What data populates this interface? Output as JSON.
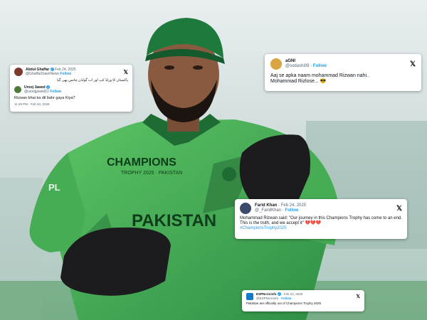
{
  "tweets": [
    {
      "name": "Abdul Ghaffar",
      "handle": "@GhaffarDawnNews",
      "date": "Feb 24, 2025",
      "follow": "Follow",
      "text": "پاکستان کا ورلڈ کپ اور اب گولڈن چانس بھی گیا",
      "reply_name": "Urooj Jawed",
      "reply_handle": "@uroojjawed12",
      "reply_follow": "Follow",
      "reply_text": "Rizwan bhai ka dil bahr gaya Kiya?",
      "time": "11:29 PM · Feb 24, 2025",
      "x_logo": "𝕏"
    },
    {
      "name": "aGNI",
      "handle": "@sodashi09",
      "follow": "Follow",
      "text_line1": "Aaj se apka naam mohammad Rizwan nahi..",
      "text_line2": "Mohammad Rizlose... 😎",
      "x_logo": "𝕏"
    },
    {
      "name": "Farid Khan",
      "handle": "@_FaridKhan",
      "date": "Feb 24, 2025",
      "follow": "Follow",
      "text": "Mohammad Rizwan said: \"Our journey in this Champions Trophy has come to an end. This is the truth, and we accept it\" 💔💔💔",
      "hashtag": "#ChampionsTrophy2025",
      "x_logo": "𝕏"
    },
    {
      "name": "ESPNcricinfo",
      "handle": "@ESPNcricinfo",
      "date": "Feb 24, 2025",
      "follow": "Follow",
      "text": "Pakistan are officially out of Champions Trophy 2025",
      "x_logo": "𝕏"
    }
  ],
  "jersey": {
    "champions": "CHAMPIONS",
    "trophy": "TROPHY 2025 · PAKISTAN",
    "country": "PAKISTAN",
    "sponsor": "PL"
  },
  "colors": {
    "jersey_green": "#3fa84f",
    "jersey_dark": "#1f6b34",
    "cap_green": "#1e7a3c",
    "gloves": "#1c1c1e",
    "skin": "#8a5a40",
    "twitter_blue": "#1d9bf0"
  }
}
